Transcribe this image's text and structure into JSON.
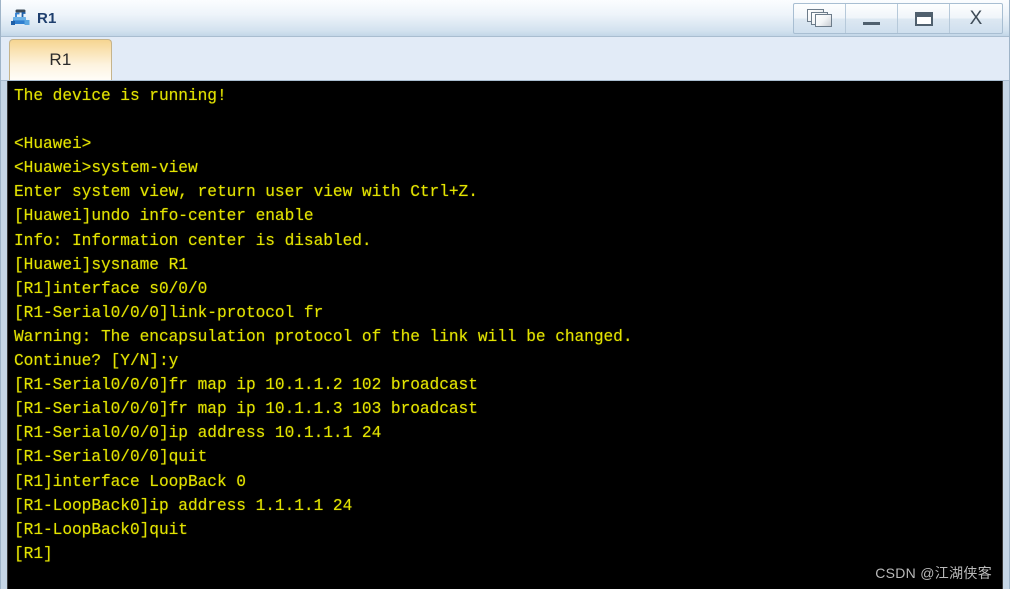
{
  "window": {
    "title": "R1",
    "icon": "router-icon",
    "controls": [
      {
        "name": "cascade-button",
        "label": "",
        "icon": "cascade-windows-icon"
      },
      {
        "name": "minimize-button",
        "label": "",
        "icon": "minimize-icon"
      },
      {
        "name": "maximize-button",
        "label": "",
        "icon": "maximize-icon"
      },
      {
        "name": "close-button",
        "label": "X",
        "icon": "close-icon"
      }
    ]
  },
  "tabs": [
    {
      "label": "R1",
      "active": true
    }
  ],
  "terminal": {
    "foreground_color": "#e3e300",
    "background_color": "#000000",
    "lines": [
      "The device is running!",
      "",
      "<Huawei>",
      "<Huawei>system-view",
      "Enter system view, return user view with Ctrl+Z.",
      "[Huawei]undo info-center enable",
      "Info: Information center is disabled.",
      "[Huawei]sysname R1",
      "[R1]interface s0/0/0",
      "[R1-Serial0/0/0]link-protocol fr",
      "Warning: The encapsulation protocol of the link will be changed.",
      "Continue? [Y/N]:y",
      "[R1-Serial0/0/0]fr map ip 10.1.1.2 102 broadcast",
      "[R1-Serial0/0/0]fr map ip 10.1.1.3 103 broadcast",
      "[R1-Serial0/0/0]ip address 10.1.1.1 24",
      "[R1-Serial0/0/0]quit",
      "[R1]interface LoopBack 0",
      "[R1-LoopBack0]ip address 1.1.1.1 24",
      "[R1-LoopBack0]quit",
      "[R1]"
    ]
  },
  "watermark": {
    "text": "CSDN @江湖侠客"
  }
}
